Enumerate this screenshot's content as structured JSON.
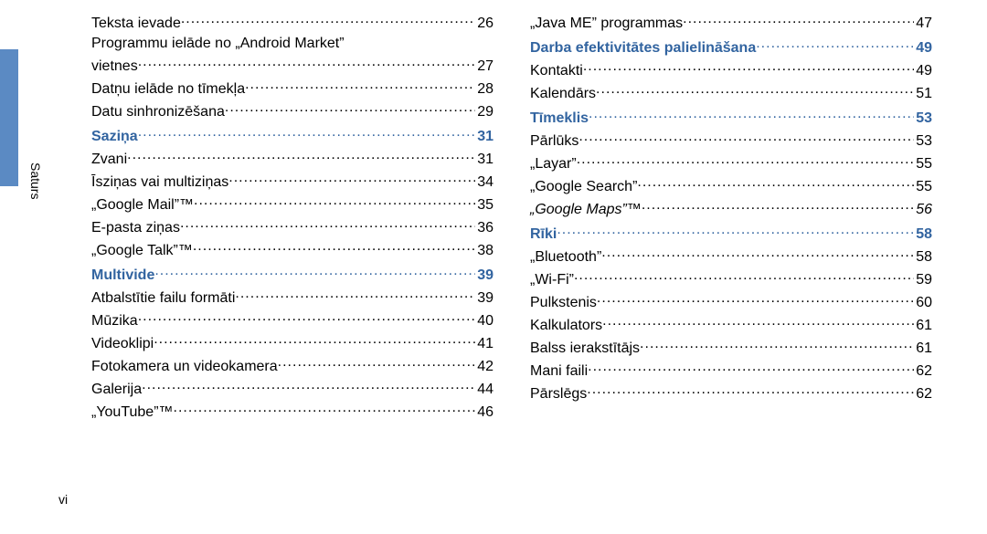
{
  "side_label": "Saturs",
  "page_number": "vi",
  "leftColumn": [
    {
      "label": "Teksta ievade",
      "page": "26"
    },
    {
      "label": "Programmu ielāde no „Android Market” vietnes",
      "page": "27",
      "wrap": true
    },
    {
      "label": "Datņu ielāde no tīmekļa",
      "page": "28"
    },
    {
      "label": "Datu sinhronizēšana",
      "page": "29"
    },
    {
      "label": "Saziņa",
      "page": "31",
      "section": true
    },
    {
      "label": "Zvani",
      "page": "31"
    },
    {
      "label": "Īsziņas vai multiziņas",
      "page": "34"
    },
    {
      "label": "„Google Mail”™",
      "page": "35"
    },
    {
      "label": "E-pasta ziņas",
      "page": "36"
    },
    {
      "label": "„Google Talk”™",
      "page": "38"
    },
    {
      "label": "Multivide",
      "page": "39",
      "section": true
    },
    {
      "label": "Atbalstītie failu formāti",
      "page": "39"
    },
    {
      "label": "Mūzika",
      "page": "40"
    },
    {
      "label": "Videoklipi",
      "page": "41"
    },
    {
      "label": "Fotokamera un videokamera",
      "page": "42"
    },
    {
      "label": "Galerija",
      "page": "44"
    },
    {
      "label": "„YouTube”™",
      "page": "46"
    }
  ],
  "rightColumn": [
    {
      "label": "„Java ME” programmas",
      "page": "47"
    },
    {
      "label": "Darba efektivitātes palielināšana",
      "page": "49",
      "section": true
    },
    {
      "label": "Kontakti",
      "page": "49"
    },
    {
      "label": "Kalendārs",
      "page": "51"
    },
    {
      "label": "Tīmeklis",
      "page": "53",
      "section": true
    },
    {
      "label": "Pārlūks",
      "page": "53"
    },
    {
      "label": "„Layar”",
      "page": "55"
    },
    {
      "label": "„Google Search”",
      "page": "55"
    },
    {
      "label": "„Google Maps”™",
      "page": "56",
      "italic": true
    },
    {
      "label": "Rīki",
      "page": "58",
      "section": true
    },
    {
      "label": "„Bluetooth”",
      "page": "58"
    },
    {
      "label": "„Wi-Fi”",
      "page": "59"
    },
    {
      "label": "Pulkstenis",
      "page": "60"
    },
    {
      "label": "Kalkulators",
      "page": "61"
    },
    {
      "label": "Balss ierakstītājs",
      "page": "61"
    },
    {
      "label": "Mani faili",
      "page": "62"
    },
    {
      "label": "Pārslēgs",
      "page": "62"
    }
  ]
}
